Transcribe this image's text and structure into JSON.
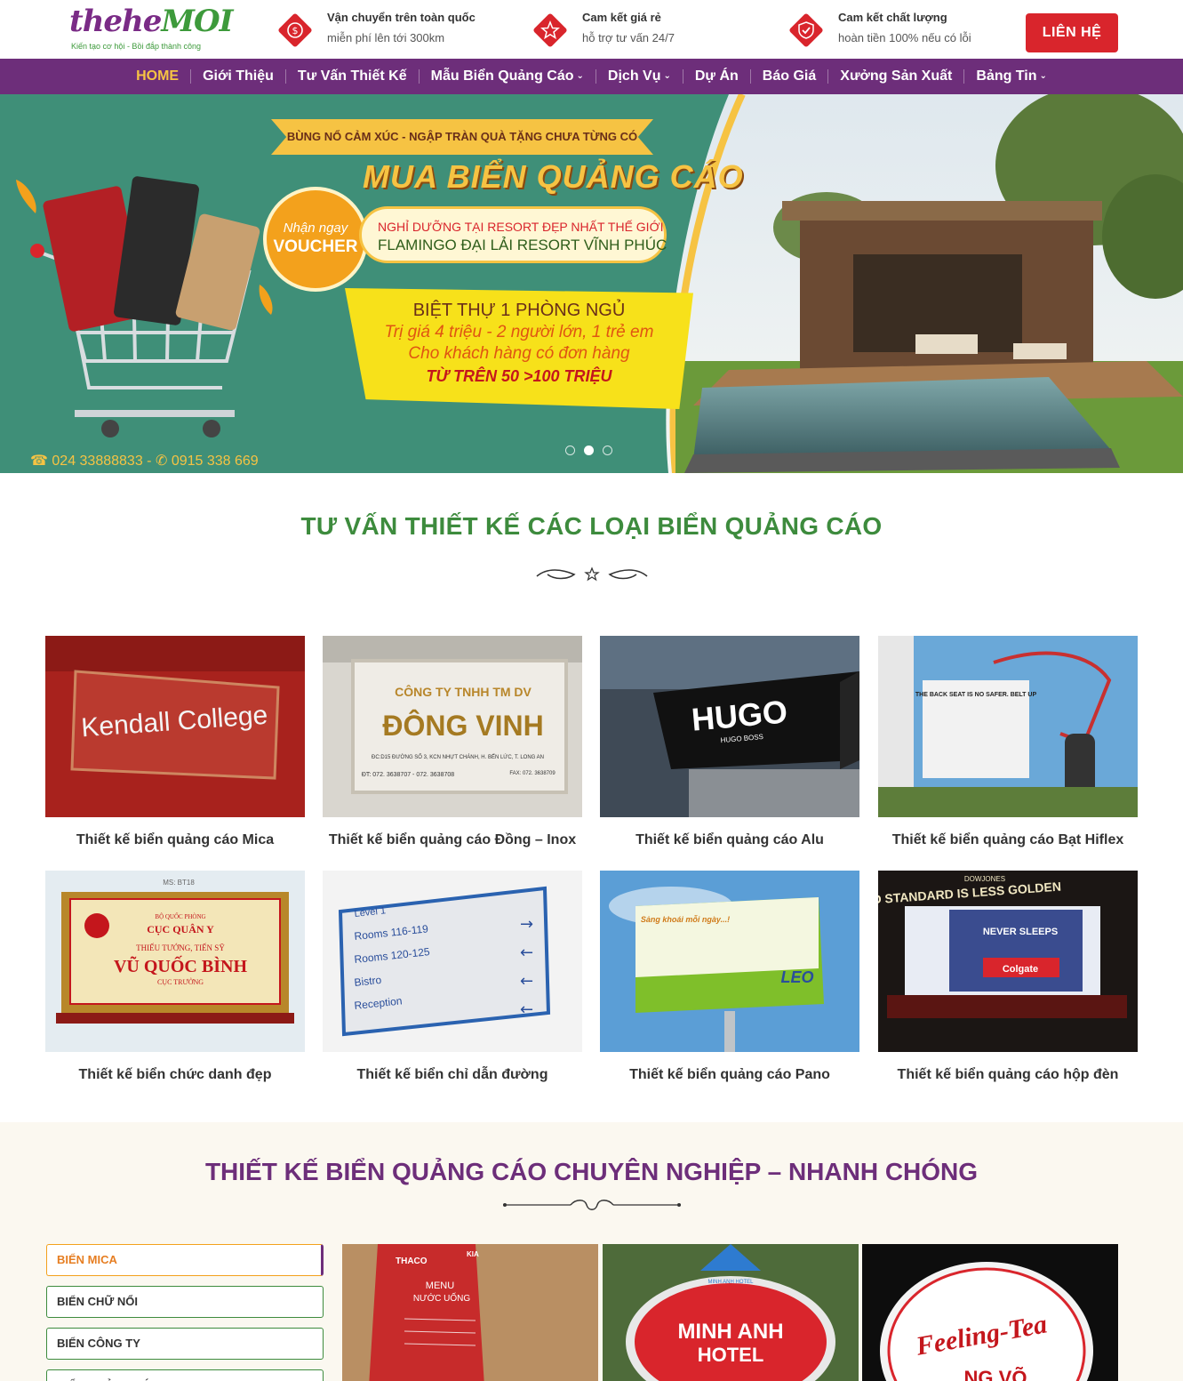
{
  "header": {
    "logo": {
      "main_a": "thehe",
      "main_b": "MOI",
      "tagline": "Kiến tạo cơ hội - Bồi đắp thành công"
    },
    "features": [
      {
        "icon": "money-icon",
        "title": "Vận chuyển trên toàn quốc",
        "subtitle": "miễn phí lên tới 300km"
      },
      {
        "icon": "star-icon",
        "title": "Cam kết giá rẻ",
        "subtitle": "hỗ trợ tư vấn 24/7"
      },
      {
        "icon": "shield-check-icon",
        "title": "Cam kết chất lượng",
        "subtitle": "hoàn tiền 100% nếu có lỗi"
      }
    ],
    "contact_button": "LIÊN HỆ",
    "colors": {
      "accent_red": "#d9252c",
      "brand_purple": "#6d2e7a",
      "brand_green": "#3d8b3d",
      "gold": "#f6c343"
    }
  },
  "nav": {
    "items": [
      {
        "label": "HOME",
        "active": true
      },
      {
        "label": "Giới Thiệu"
      },
      {
        "label": "Tư Vấn Thiết Kế"
      },
      {
        "label": "Mẫu Biển Quảng Cáo",
        "dropdown": true
      },
      {
        "label": "Dịch Vụ",
        "dropdown": true
      },
      {
        "label": "Dự Án"
      },
      {
        "label": "Báo Giá"
      },
      {
        "label": "Xưởng Sản Xuất"
      },
      {
        "label": "Bảng Tin",
        "dropdown": true
      }
    ]
  },
  "hero": {
    "ribbon": "BÙNG NỔ CẢM XÚC - NGẬP TRÀN QUÀ TẶNG CHƯA TỪNG CÓ",
    "title": "MUA BIỂN QUẢNG CÁO",
    "voucher_line1": "Nhận ngay",
    "voucher_line2": "VOUCHER",
    "resort_line1": "NGHỈ DƯỠNG TẠI RESORT ĐẸP NHẤT THẾ GIỚI",
    "resort_line2": "FLAMINGO ĐẠI LẢI RESORT VĨNH PHÚC",
    "offer_line1": "BIỆT THỰ 1 PHÒNG NGỦ",
    "offer_line2": "Trị giá 4 triệu - 2 người lớn, 1 trẻ em",
    "offer_line3": "Cho khách hàng có đơn hàng",
    "offer_line4": "TỪ TRÊN 50 >100 TRIỆU",
    "phone": "024 33888833 -",
    "mobile": "0915 338 669",
    "slides": 3,
    "active_slide": 2
  },
  "section1": {
    "title": "TƯ VẤN THIẾT KẾ CÁC LOẠI BIỂN QUẢNG CÁO",
    "cards": [
      {
        "caption": "Thiết kế biển quảng cáo Mica",
        "img_text": "Kendall College"
      },
      {
        "caption": "Thiết kế biển quảng cáo Đồng – Inox",
        "img_text1": "CÔNG TY TNHH TM DV",
        "img_text2": "ĐÔNG VINH",
        "img_text3": "ĐC:D15 ĐƯỜNG SỐ 3, KCN NHỰT CHÁNH, H. BẾN LỨC, T. LONG AN",
        "img_text4": "ĐT: 072. 3638707 - 072. 3638708",
        "img_text5": "FAX: 072. 3638709"
      },
      {
        "caption": "Thiết kế biển quảng cáo Alu",
        "img_text1": "HUGO",
        "img_text2": "HUGO BOSS"
      },
      {
        "caption": "Thiết kế biển quảng cáo Bạt Hiflex",
        "img_text": "THE BACK SEAT IS NO SAFER. BELT UP"
      },
      {
        "caption": "Thiết kế biển chức danh đẹp",
        "img_text1": "MS: BT18",
        "img_text2": "BỘ QUỐC PHÒNG",
        "img_text3": "CỤC QUÂN Y",
        "img_text4": "THIẾU TƯỚNG, TIẾN SỸ",
        "img_text5": "VŨ QUỐC BÌNH",
        "img_text6": "CỤC TRƯỞNG"
      },
      {
        "caption": "Thiết kế biển chỉ dẫn đường",
        "rows": [
          "Level 1",
          "Rooms 116-119",
          "Rooms 120-125",
          "Bistro",
          "Reception"
        ]
      },
      {
        "caption": "Thiết kế biển quảng cáo Pano",
        "img_text1": "Sảng khoái mỗi ngày...!",
        "img_text2": "LEO"
      },
      {
        "caption": "Thiết kế biển quảng cáo hộp đèn",
        "img_text1": "DOWJONES",
        "img_text2": "D STANDARD IS LESS GOLDEN",
        "img_text3": "NEVER SLEEPS",
        "img_text4": "Colgate"
      }
    ]
  },
  "section2": {
    "title": "THIẾT KẾ BIỂN QUẢNG CÁO CHUYÊN NGHIỆP – NHANH CHÓNG",
    "tabs": [
      {
        "label": "Biển Mica",
        "active": true
      },
      {
        "label": "Biển chữ nổi"
      },
      {
        "label": "Biển công ty"
      },
      {
        "label": "Biển quảng cáo LED"
      }
    ],
    "gallery": [
      {
        "img_text1": "THACO",
        "img_text2": "KIA",
        "img_text3": "MENU",
        "img_text4": "NƯỚC UỐNG"
      },
      {
        "img_text1": "MINH ANH",
        "img_text2": "HOTEL",
        "img_text3": "MINH ANH HOTEL"
      },
      {
        "img_text1": "Feeling-Tea",
        "img_text2": "NG VÕ"
      }
    ]
  }
}
